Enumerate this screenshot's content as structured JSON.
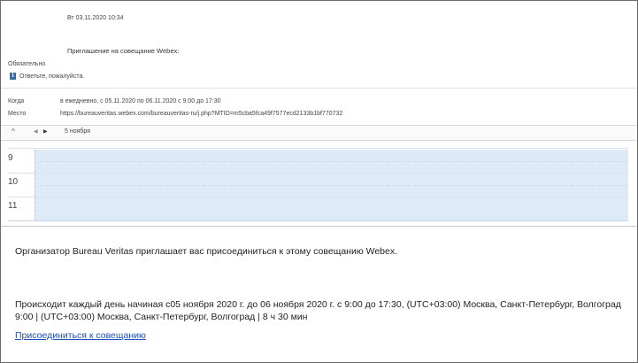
{
  "meeting": {
    "date": "Вт 03.11.2020 10:34",
    "subject": "Приглашение на совещание Webex:",
    "required": "Обязательно",
    "reply_prompt": "Ответьте, пожалуйста.",
    "when_label": "Когда",
    "when_value": "в ежедневно, с 05.11.2020 по 06.11.2020 с 9:00 до 17:30",
    "where_label": "Место",
    "where_value": "https://bureauveritas.webex.com/bureauveritas-ru/j.php?MTID=m5cba5fca49f7577ecd2133b1bf770732"
  },
  "calendar": {
    "nav_up": "^",
    "nav_prev": "◀",
    "nav_next": "▶",
    "current_date": "5 ноября",
    "hours": [
      "9",
      "10",
      "11"
    ]
  },
  "body": {
    "paragraph1": "Организатор Bureau Veritas приглашает вас присоединиться к этому совещанию Webex.",
    "paragraph2": "Происходит каждый день начиная с05 ноября 2020 г. до 06 ноября 2020 г. с 9:00 до 17:30, (UTC+03:00) Москва, Санкт-Петербург, Волгоград 9:00  |  (UTC+03:00) Москва, Санкт-Петербург, Волгоград  |  8 ч 30 мин",
    "join_link": "Присоединиться к совещанию"
  },
  "colors": {
    "link": "#1f4fb8",
    "calendar_slot": "#ddeaf8",
    "info_icon": "#2f6db5"
  },
  "icons": {
    "info": "info-icon"
  }
}
